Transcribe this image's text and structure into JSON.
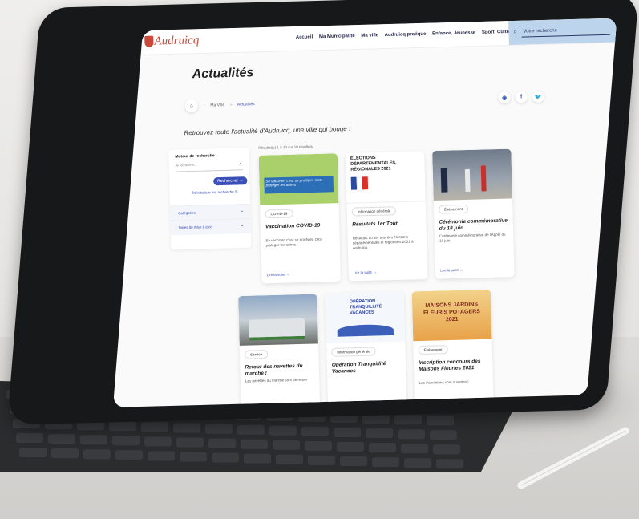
{
  "site": {
    "logo_text": "Audruicq"
  },
  "nav": {
    "items": [
      "Accueil",
      "Ma Municipalité",
      "Ma ville",
      "Audruicq pratique",
      "Enfance, Jeunesse",
      "Sport, Culture, Loisirs"
    ]
  },
  "search": {
    "placeholder": "Votre recherche"
  },
  "page": {
    "title": "Actualités",
    "intro": "Retrouvez toute l'actualité d'Audruicq, une ville qui bouge !"
  },
  "breadcrumb": {
    "items": [
      "Ma Ville",
      "Actualités"
    ]
  },
  "social": {
    "icons": [
      "instagram-icon",
      "facebook-icon",
      "twitter-icon"
    ],
    "labels": [
      "◉",
      "f",
      "🐦"
    ]
  },
  "sidebar": {
    "title": "Moteur de recherche",
    "placeholder": "Je recherche...",
    "submit": "Rechercher",
    "reset": "Réinitialiser ma recherche",
    "filters": [
      "Catégories",
      "Dates de mise à jour"
    ]
  },
  "results": {
    "count_text": "Résultat(s) 1 à 10 sur 10 résultats"
  },
  "cards": [
    {
      "tag": "COVID-19",
      "title": "Vaccination COVID-19",
      "desc": "Se vacciner, c'est se protéger, c'est protéger les autres.",
      "more": "Lire la suite",
      "image_text": "Se vacciner, c'est se protéger, c'est protéger les autres"
    },
    {
      "tag": "Information générale",
      "title": "Résultats 1er Tour",
      "desc": "Résultats du 1er tour des élections départementales et régionales 2021 à Audruicq.",
      "more": "Lire la suite",
      "image_text": "ÉLECTIONS DÉPARTEMENTALES, RÉGIONALES 2021"
    },
    {
      "tag": "Événement",
      "title": "Cérémonie commémorative du 18 juin",
      "desc": "Cérémonie commémorative de l'Appel du 18 juin.",
      "more": "Lire la suite",
      "image_text": ""
    },
    {
      "tag": "Service",
      "title": "Retour des navettes du marché !",
      "desc": "Les navettes du marché sont de retour",
      "more": "",
      "image_text": ""
    },
    {
      "tag": "Information générale",
      "title": "Opération Tranquillité Vacances",
      "desc": "",
      "more": "",
      "image_text": "OPÉRATION TRANQUILLITÉ VACANCES"
    },
    {
      "tag": "Événement",
      "title": "Inscription concours des Maisons Fleuries 2021",
      "desc": "Les inscriptions sont ouvertes !",
      "more": "",
      "image_text": "MAISONS JARDINS FLEURIS POTAGERS 2021"
    }
  ],
  "colors": {
    "accent": "#3a4fb8",
    "brand": "#c94a3b",
    "search_bg": "#bcd5ec"
  }
}
